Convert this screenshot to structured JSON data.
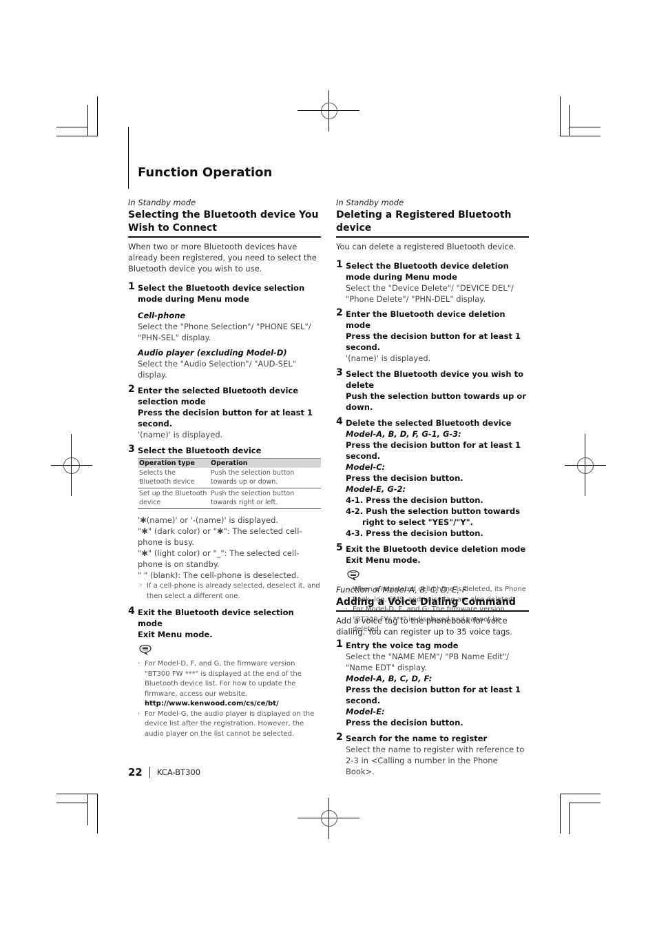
{
  "page": {
    "title": "Function Operation",
    "page_number": "22",
    "model": "KCA-BT300"
  },
  "left": {
    "mode": "In Standby mode",
    "title": "Selecting the Bluetooth device You Wish to Connect",
    "intro": "When two or more Bluetooth devices have already been registered, you need to select the Bluetooth device you wish to use.",
    "steps": [
      {
        "num": "1",
        "head": "Select the Bluetooth device selection mode during Menu mode",
        "cell_label": "Cell-phone",
        "cell_text": "Select the \"Phone Selection\"/ \"PHONE SEL\"/ \"PHN-SEL\" display.",
        "audio_label": "Audio player (excluding Model-D)",
        "audio_text": "Select the \"Audio Selection\"/ \"AUD-SEL\" display."
      },
      {
        "num": "2",
        "head": "Enter the selected Bluetooth device selection mode",
        "action": "Press the decision button for at least 1 second.",
        "result": "'(name)' is displayed."
      },
      {
        "num": "3",
        "head": "Select the Bluetooth device",
        "table": {
          "headers": [
            "Operation type",
            "Operation"
          ],
          "rows": [
            [
              "Selects the Bluetooth device",
              "Push the selection button towards up or down."
            ],
            [
              "Set up the Bluetooth device",
              "Push the selection button towards right or left."
            ]
          ]
        },
        "notes": [
          "'✱(name)' or '-(name)' is displayed.",
          "\"✱\" (dark color) or \"✱\": The selected cell-phone is busy.",
          "\"✱\" (light color) or \"_\": The selected cell-phone is on standby.",
          "\"  \" (blank): The cell-phone is deselected."
        ],
        "tip": "If a cell-phone is already selected, deselect it, and then select a different one."
      },
      {
        "num": "4",
        "head": "Exit the Bluetooth device selection mode",
        "action": "Exit Menu mode.",
        "bullets": [
          "For Model-D, F, and G, the firmware version \"BT300 FW ***\" is displayed at the end of the Bluetooth device list. For how to update the firmware, access our website.",
          "For Model-G, the audio player is displayed on the device list after the registration. However, the audio player on the list cannot be selected."
        ],
        "url": "http://www.kenwood.com/cs/ce/bt/"
      }
    ]
  },
  "right_top": {
    "mode": "In Standby mode",
    "title": "Deleting a Registered Bluetooth device",
    "intro": "You can delete a registered Bluetooth device.",
    "steps": [
      {
        "num": "1",
        "head": "Select the Bluetooth device deletion mode during Menu mode",
        "text": "Select the \"Device Delete\"/ \"DEVICE DEL\"/ \"Phone Delete\"/ \"PHN-DEL\" display."
      },
      {
        "num": "2",
        "head": "Enter the Bluetooth device deletion mode",
        "action": "Press the decision button for at least 1 second.",
        "result": "'(name)' is displayed."
      },
      {
        "num": "3",
        "head": "Select the Bluetooth device you wish to delete",
        "action": "Push the selection button towards up or down."
      },
      {
        "num": "4",
        "head": "Delete the selected Bluetooth device",
        "m1_label": "Model-A, B, D, F, G-1, G-3:",
        "m1_action": "Press the decision button for at least 1 second.",
        "m2_label": "Model-C:",
        "m2_action": "Press the decision button.",
        "m3_label": "Model-E, G-2:",
        "m3_steps": [
          "4-1. Press the decision button.",
          "4-2. Push the selection button towards right to select \"YES\"/\"Y\".",
          "4-3. Press the decision button."
        ]
      },
      {
        "num": "5",
        "head": "Exit the Bluetooth device deletion mode",
        "action": "Exit Menu mode.",
        "bullets": [
          "When a registered cell-phone is deleted, its Phone Book, log, SMS, and voice tag are also deleted.",
          "For Model-D, F, and G: The firmware version \"BT300 FW ***\" is displayed and cannot be deleted."
        ]
      }
    ]
  },
  "right_bottom": {
    "mode": "Function of Model-A, B, C, D, E, F",
    "title": "Adding a Voice Dialing Command",
    "intro": "Add a voice tag to the phonebook for voice dialing. You can register up to 35 voice tags.",
    "steps": [
      {
        "num": "1",
        "head": "Entry the voice tag mode",
        "text": "Select the \"NAME MEM\"/ \"PB Name Edit\"/ \"Name EDT\" display.",
        "m1_label": "Model-A, B, C, D, F:",
        "m1_action": "Press the decision button for at least 1 second.",
        "m2_label": "Model-E:",
        "m2_action": "Press the decision button."
      },
      {
        "num": "2",
        "head": "Search for the name to register",
        "text": "Select the name to register with reference to 2-3 in <Calling a number in the Phone Book>."
      }
    ]
  }
}
